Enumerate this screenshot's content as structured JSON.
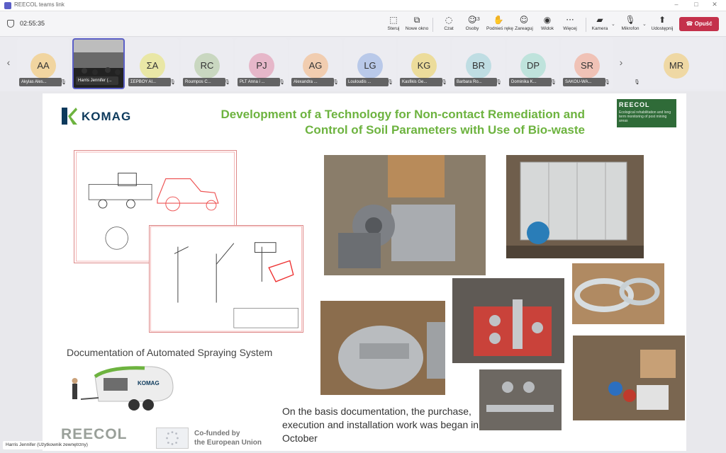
{
  "window": {
    "title": "REECOL teams link"
  },
  "toolbar": {
    "timer": "02:55:35",
    "buttons": [
      {
        "label": "Steruj",
        "icon": "share-screen-icon"
      },
      {
        "label": "Nowe okno",
        "icon": "new-window-icon"
      },
      {
        "label": "Czat",
        "icon": "chat-icon"
      },
      {
        "label": "Osoby",
        "icon": "people-icon",
        "count": "13"
      },
      {
        "label": "Podnieś rękę",
        "icon": "raise-hand-icon"
      },
      {
        "label": "Zareaguj",
        "icon": "react-icon"
      },
      {
        "label": "Widok",
        "icon": "view-icon"
      },
      {
        "label": "Więcej",
        "icon": "more-icon"
      },
      {
        "label": "Kamera",
        "icon": "camera-off-icon"
      },
      {
        "label": "Mikrofon",
        "icon": "mic-off-icon"
      },
      {
        "label": "Udostępnij",
        "icon": "share-icon"
      }
    ],
    "leave_label": "Opuść",
    "colors": {
      "leave": "#c4314b",
      "accent": "#5b5fc7"
    }
  },
  "participants": [
    {
      "initials": "AA",
      "name": "Akylas Ales...",
      "color": "#f1d5a0"
    },
    {
      "initials": "",
      "name": "Harris Jennifer (...",
      "color": "#3a3a3a",
      "video": true
    },
    {
      "initials": "ΣA",
      "name": "ΣΕΡΒΟΥ ΑΙ...",
      "color": "#e9e7a6"
    },
    {
      "initials": "RC",
      "name": "Roumpos C...",
      "color": "#c9d7c0"
    },
    {
      "initials": "PJ",
      "name": "PLT Anna i ...",
      "color": "#e6b7c9"
    },
    {
      "initials": "AG",
      "name": "Alexandra ...",
      "color": "#f1cdb0"
    },
    {
      "initials": "LG",
      "name": "Louloudis ...",
      "color": "#b9c9e9"
    },
    {
      "initials": "KG",
      "name": "Kasfikis Ge...",
      "color": "#ecdc9b"
    },
    {
      "initials": "BR",
      "name": "Barbara Ro...",
      "color": "#bfdde3"
    },
    {
      "initials": "DP",
      "name": "Dominika K...",
      "color": "#bfe3dc"
    },
    {
      "initials": "SR",
      "name": "SAKOU-WA...",
      "color": "#f0c2b6"
    },
    {
      "initials": "MR",
      "name": "",
      "color": "#efd8a4"
    }
  ],
  "slide": {
    "komag_logo": "KOMAG",
    "title_line1": "Development of a Technology for Non-contact Remediation and",
    "title_line2": "Control of Soil Parameters with Use of Bio-waste",
    "reecol_logo": "REECOL",
    "reecol_sub": "Ecological rehabilitation and long term monitoring of post mining areas",
    "caption_docs": "Documentation of Automated Spraying System",
    "caption_basis": "On the basis documentation, the purchase, execution and installation work was began in October",
    "trailer_logo": "KOMAG",
    "footer_reecol": "REECOL",
    "footer_eu_line1": "Co-funded by",
    "footer_eu_line2": "the European Union",
    "title_color": "#6db33f"
  },
  "speaker": {
    "label": "Harris Jennifer (Użytkownik zewnętrzny)"
  }
}
